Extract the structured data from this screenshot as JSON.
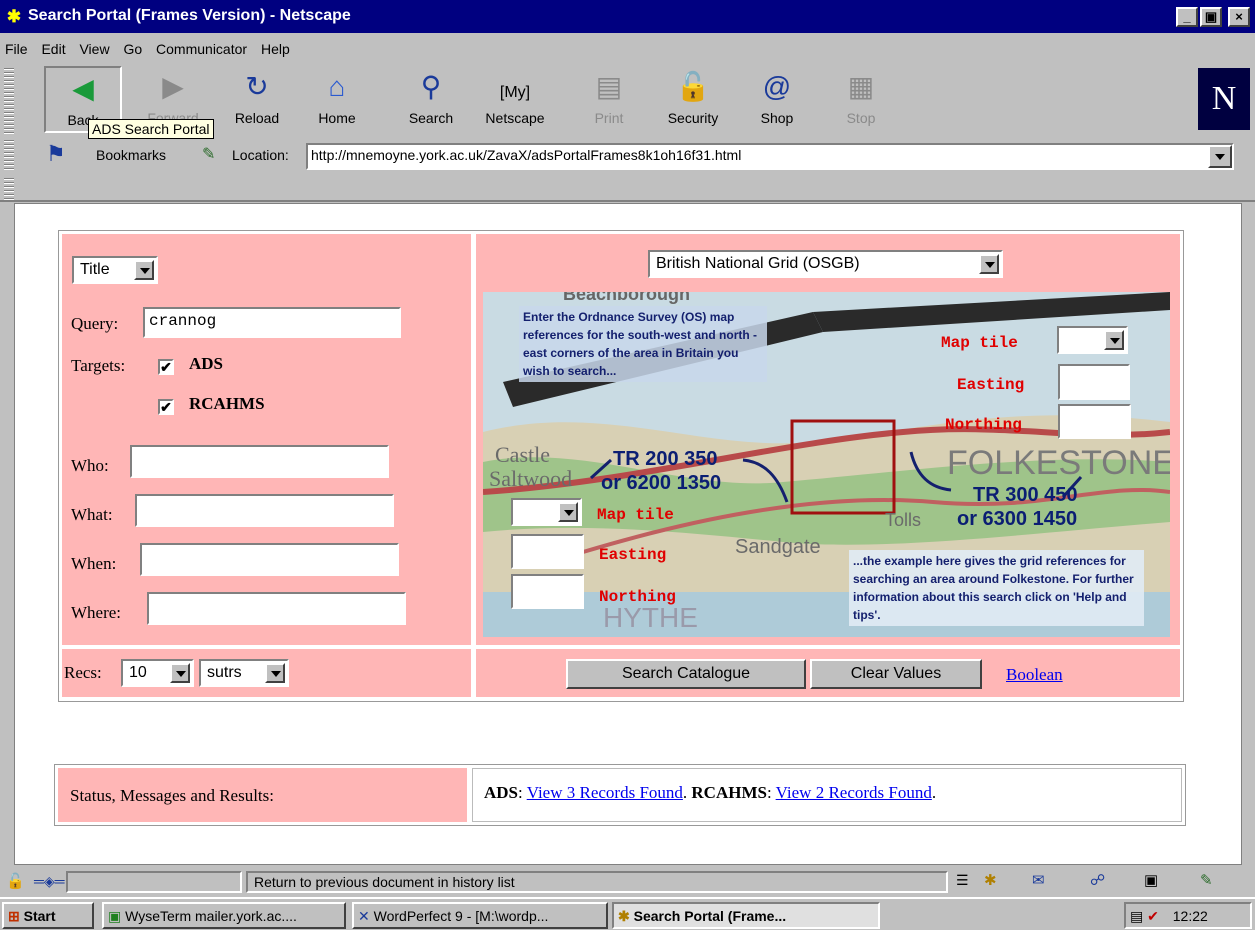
{
  "window": {
    "title": "Search Portal (Frames Version) - Netscape",
    "minimize": "_",
    "maximize": "▣",
    "close": "×"
  },
  "menu": [
    "File",
    "Edit",
    "View",
    "Go",
    "Communicator",
    "Help"
  ],
  "toolbar": {
    "back": "Back",
    "forward": "Forward",
    "reload": "Reload",
    "home": "Home",
    "search": "Search",
    "netscape": "Netscape",
    "print": "Print",
    "security": "Security",
    "shop": "Shop",
    "stop": "Stop",
    "tooltip": "ADS Search Portal",
    "logo": "N"
  },
  "location": {
    "bookmarks": "Bookmarks",
    "label": "Location:",
    "url": "http://mnemoyne.york.ac.uk/ZavaX/adsPortalFrames8k1oh16f31.html"
  },
  "left": {
    "field_select": "Title",
    "query_label": "Query:",
    "query_value": "crannog",
    "targets_label": "Targets:",
    "target1": "ADS",
    "target2": "RCAHMS",
    "check": "✔",
    "who_label": "Who:",
    "what_label": "What:",
    "when_label": "When:",
    "where_label": "Where:",
    "recs_label": "Recs:",
    "recs_value": "10",
    "format_value": "sutrs"
  },
  "right": {
    "grid_select": "British National Grid (OSGB)",
    "intro": "Enter the Ordnance Survey (OS) map references for the south-west and north -east corners of the area in Britain you wish to search...",
    "sw_ref": "TR 200 350",
    "sw_ref2": "or 6200 1350",
    "ne_ref": "TR 300 450",
    "ne_ref2": "or 6300 1450",
    "map_tile": "Map tile",
    "easting": "Easting",
    "northing": "Northing",
    "example": "...the example here gives the grid references for searching an area around Folkestone. For further information about this search click on 'Help and tips'.",
    "place_folkestone": "FOLKESTONE",
    "place_sandgate": "Sandgate",
    "place_castle": "Castle",
    "place_saltwood": "Saltwood",
    "place_hythe": "HYTHE",
    "place_tolls": "Tolls",
    "place_top": "Beachborough",
    "search_btn": "Search Catalogue",
    "clear_btn": "Clear Values",
    "boolean": "Boolean"
  },
  "status_panel": {
    "label": "Status, Messages and Results:",
    "ads": "ADS",
    "ads_link": "View 3 Records Found",
    "rcahms": "RCAHMS",
    "rcahms_link": "View 2 Records Found"
  },
  "statusbar": {
    "message": "Return to previous document in history list"
  },
  "taskbar": {
    "start": "Start",
    "task1": "WyseTerm mailer.york.ac....",
    "task2": "WordPerfect 9 - [M:\\wordp...",
    "task3": "Search Portal (Frame...",
    "clock": "12:22"
  }
}
